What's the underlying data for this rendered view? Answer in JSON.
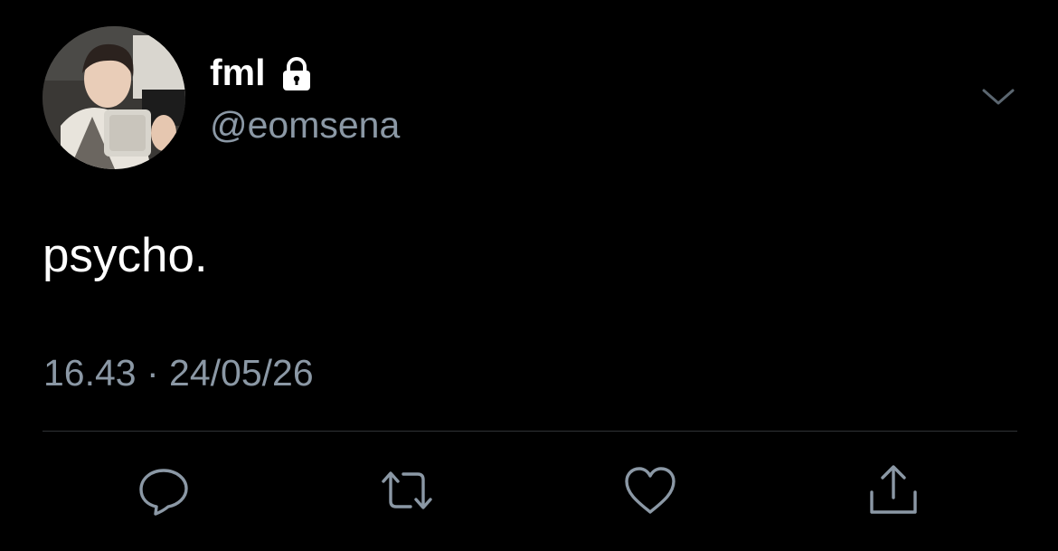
{
  "user": {
    "display_name": "fml",
    "handle": "@eomsena",
    "protected_icon": "lock-icon",
    "avatar_icon": "profile-photo"
  },
  "tweet": {
    "text": "psycho.",
    "timestamp": "16.43 · 24/05/26"
  },
  "actions": [
    {
      "name": "reply",
      "icon": "speech-bubble-icon"
    },
    {
      "name": "retweet",
      "icon": "retweet-arrows-icon"
    },
    {
      "name": "like",
      "icon": "heart-icon"
    },
    {
      "name": "share",
      "icon": "share-upload-icon"
    }
  ],
  "menu_icon": "chevron-down-icon",
  "colors": {
    "background": "#000000",
    "primary_text": "#ffffff",
    "secondary_text": "#8b98a5",
    "divider": "#2f3336",
    "icon": "#8b98a5"
  }
}
